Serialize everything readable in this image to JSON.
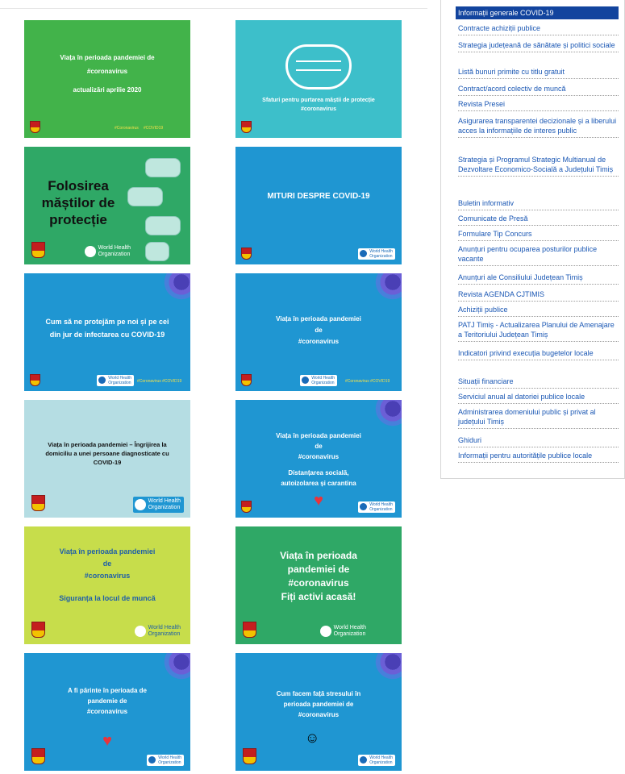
{
  "colors": {
    "green": "#42b34a",
    "teal": "#3dbfca",
    "seagreen": "#2fa866",
    "blue": "#1f96d2",
    "lightblue": "#b5dde3",
    "lime": "#c7dd4b",
    "menuActive": "#12449e",
    "menuLink": "#1a57b4"
  },
  "cards": {
    "c1": {
      "title": "Viața în perioada pandemiei de\n#coronavirus",
      "sub": "actualizări aprilie 2020",
      "tag1": "#Coronavirus",
      "tag2": "#COVID19"
    },
    "c2": {
      "title": "Sfaturi pentru purtarea măștii de protecție\n#coronavirus"
    },
    "c3": {
      "title": "Folosirea\nmăștilor de\nprotecție",
      "who": "World Health\nOrganization"
    },
    "c4": {
      "title": "MITURI DESPRE COVID-19",
      "who": "World Health\nOrganization"
    },
    "c5": {
      "title": "Cum să ne protejăm pe noi și pe cei\ndin jur de infectarea cu COVID-19",
      "who": "World Health\nOrganization",
      "tags": "#Coronavirus  #COVID19"
    },
    "c6": {
      "title": "Viața în perioada pandemiei\nde\n#coronavirus",
      "who": "World Health\nOrganization",
      "tags": "#Coronavirus  #COVID19"
    },
    "c7": {
      "title": "Viața în perioada pandemiei – Îngrijirea la\ndomiciliu a unei persoane diagnosticate cu\nCOVID-19",
      "who": "World Health\nOrganization"
    },
    "c8": {
      "title": "Viața în perioada pandemiei\nde\n#coronavirus",
      "sub": "Distanțarea socială,\nautoizolarea și carantina",
      "who": "World Health\nOrganization"
    },
    "c9": {
      "title": "Viața în perioada pandemiei\nde\n#coronavirus",
      "sub": "Siguranța la locul de muncă",
      "who": "World Health\nOrganization"
    },
    "c10": {
      "title": "Viața în perioada\npandemiei de\n#coronavirus\nFiți activi acasă!",
      "who": "World Health\nOrganization"
    },
    "c11": {
      "title": "A fi părinte în perioada de\npandemie de\n#coronavirus",
      "who": "World Health\nOrganization"
    },
    "c12": {
      "title": "Cum facem față stresului în\nperioada pandemiei de\n#coronavirus",
      "who": "World Health\nOrganization"
    }
  },
  "menu": {
    "active": "Informații generale COVID-19",
    "items": [
      "Contracte achiziții publice",
      "Strategia județeană de sănătate și politici sociale",
      "Listă bunuri primite cu titlu gratuit",
      "Contract/acord colectiv de muncă",
      "Revista Presei",
      "Asigurarea transparentei decizionale și a liberului acces la informațiile de interes public",
      "Strategia și Programul Strategic Multianual de Dezvoltare Economico-Socială a Județului Timiș",
      "Buletin informativ",
      "Comunicate de Presă",
      "Formulare Tip Concurs",
      "Anunțuri pentru ocuparea posturilor publice vacante",
      "Anunțuri ale Consiliului Județean Timiș",
      "Revista AGENDA CJTIMIS",
      "Achiziții publice",
      "PATJ Timiș - Actualizarea Planului de Amenajare a Teritoriului Județean Timiș",
      "Indicatori privind execuția bugetelor locale",
      "Situații financiare",
      "Serviciul anual al datoriei publice locale",
      "Administrarea domeniului public și privat al județului Timiș",
      "Ghiduri",
      "Informații pentru autoritățile publice locale"
    ]
  }
}
